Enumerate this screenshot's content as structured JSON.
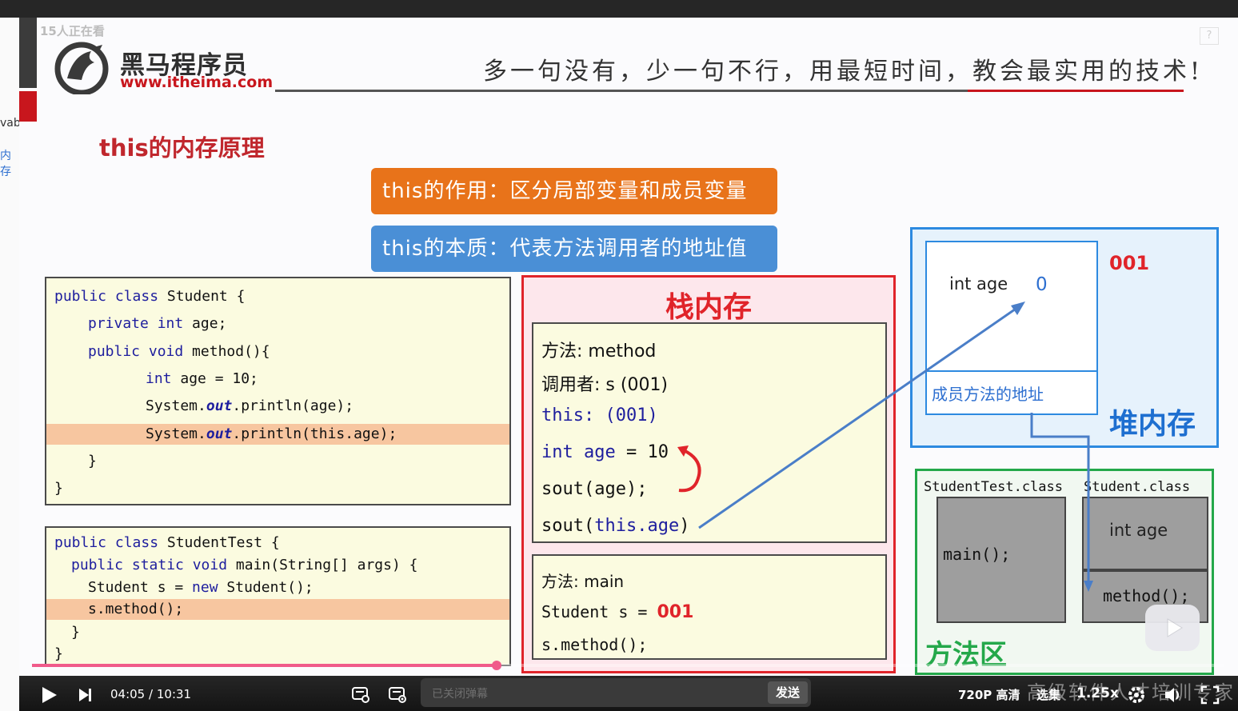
{
  "left_strip": {
    "fragment_1": "vab",
    "fragment_2": "内存"
  },
  "overlay": {
    "viewer_count": "15人正在看"
  },
  "slide": {
    "brand_name": "黑马程序员",
    "brand_url": "www.itheima.com",
    "slogan": "多一句没有，少一句不行，用最短时间，教会最实用的技术!",
    "help_badge": "?",
    "title": "this的内存原理",
    "pill_role": "this的作用：区分局部变量和成员变量",
    "pill_essence": "this的本质：代表方法调用者的地址值",
    "student_code": {
      "l1_kw": "public class",
      "l1_rest": " Student {",
      "l2_kw": "private int",
      "l2_rest": " age;",
      "l3_kw": "public void",
      "l3_rest": " method(){",
      "l4_kw": "int",
      "l4_rest": " age = 10;",
      "l5_a": "System.",
      "l5_out": "out",
      "l5_b": ".println(age);",
      "l6_a": "System.",
      "l6_out": "out",
      "l6_b": ".println(this.age);",
      "l7": "}",
      "l8": "}"
    },
    "test_code": {
      "l1_kw": "public class",
      "l1_rest": " StudentTest {",
      "l2_kw": "public static void",
      "l2_rest": " main(String[] args) {",
      "l3_a": "Student s = ",
      "l3_kw": "new",
      "l3_b": " Student();",
      "l4": "s.method();",
      "l5": "}",
      "l6": "}"
    },
    "stack": {
      "title": "栈内存",
      "method_frame": {
        "method_label": "方法: method",
        "caller_label": "调用者: s (001)",
        "this_label": "this:",
        "this_value": "(001)",
        "local_kw": "int age",
        "local_rest": " = 10",
        "line_sout_age": "sout(age);",
        "line_sout_this_a": "sout(",
        "line_sout_this_b": "this.age",
        "line_sout_this_c": ")"
      },
      "main_frame": {
        "method_label": "方法: main",
        "student_var": "Student s = ",
        "student_addr": "001",
        "call": "s.method();"
      }
    },
    "heap": {
      "title": "堆内存",
      "address": "001",
      "field_label": "int age",
      "field_value": "0",
      "method_addr_label": "成员方法的地址"
    },
    "method_area": {
      "title": "方法区",
      "class_test": "StudentTest.class",
      "class_student": "Student.class",
      "test_main": "main();",
      "student_field": "int age",
      "student_method": "method();"
    }
  },
  "player": {
    "time_current": "04:05",
    "time_sep": "/",
    "time_total": "10:31",
    "danmaku_placeholder": "已关闭弹幕",
    "send_label": "发送",
    "quality": "720P 高清",
    "episodes": "选集",
    "speed": "1.25x",
    "watermark": "高级软件人才培训专家",
    "progress": 0.39
  },
  "colors": {
    "brand_red": "#c8161d",
    "pill_orange": "#e8731a",
    "pill_blue": "#4a8fd6",
    "stack_red": "#e0242a",
    "heap_blue": "#2d8ae0",
    "method_area_green": "#24a84a",
    "progress_pink": "#f05a8a"
  }
}
